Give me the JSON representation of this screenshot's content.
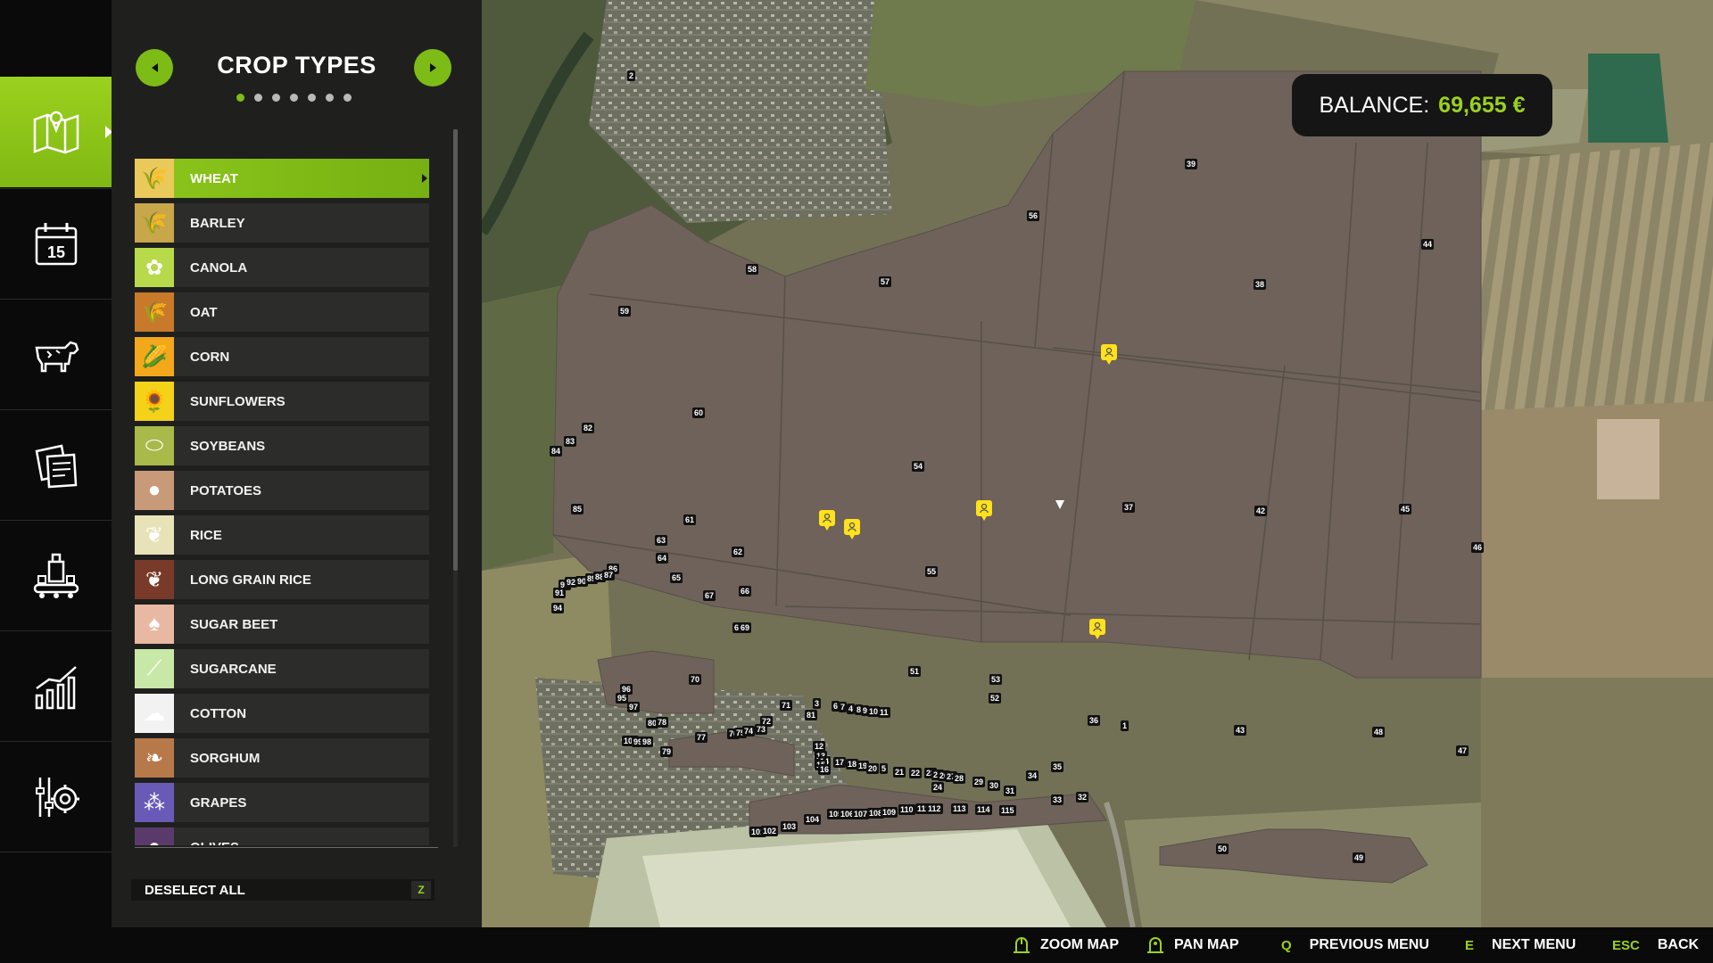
{
  "rail": {
    "items": [
      {
        "name": "map-icon",
        "active": true
      },
      {
        "name": "calendar-icon",
        "calendar_day": "15"
      },
      {
        "name": "animals-icon"
      },
      {
        "name": "contracts-icon"
      },
      {
        "name": "production-icon"
      },
      {
        "name": "statistics-icon"
      },
      {
        "name": "settings-icon"
      }
    ]
  },
  "panel": {
    "title": "CROP TYPES",
    "page_count": 7,
    "current_page": 1,
    "crops": [
      {
        "label": "WHEAT",
        "icon": "wheat-icon",
        "bg": "#e9c95a",
        "selected": true
      },
      {
        "label": "BARLEY",
        "icon": "barley-icon",
        "bg": "#c8a64a"
      },
      {
        "label": "CANOLA",
        "icon": "canola-icon",
        "bg": "#b8d94a"
      },
      {
        "label": "OAT",
        "icon": "oat-icon",
        "bg": "#c87a2a"
      },
      {
        "label": "CORN",
        "icon": "corn-icon",
        "bg": "#f2a81a"
      },
      {
        "label": "SUNFLOWERS",
        "icon": "sunflower-icon",
        "bg": "#f5d21a"
      },
      {
        "label": "SOYBEANS",
        "icon": "soybean-icon",
        "bg": "#a9b94a"
      },
      {
        "label": "POTATOES",
        "icon": "potato-icon",
        "bg": "#c99a7a"
      },
      {
        "label": "RICE",
        "icon": "rice-icon",
        "bg": "#e8e2b8"
      },
      {
        "label": "LONG GRAIN RICE",
        "icon": "long-grain-rice-icon",
        "bg": "#7a3a2a"
      },
      {
        "label": "SUGAR BEET",
        "icon": "sugar-beet-icon",
        "bg": "#e8b8a2"
      },
      {
        "label": "SUGARCANE",
        "icon": "sugarcane-icon",
        "bg": "#c8e8a8"
      },
      {
        "label": "COTTON",
        "icon": "cotton-icon",
        "bg": "#f2f2f2"
      },
      {
        "label": "SORGHUM",
        "icon": "sorghum-icon",
        "bg": "#b8794a"
      },
      {
        "label": "GRAPES",
        "icon": "grapes-icon",
        "bg": "#6a5ab8"
      },
      {
        "label": "OLIVES",
        "icon": "olive-icon",
        "bg": "#5a3a6a"
      }
    ],
    "deselect_label": "DESELECT ALL",
    "deselect_key": "Z"
  },
  "balance": {
    "label": "BALANCE:",
    "value": "69,655 €"
  },
  "map": {
    "field_numbers": [
      "2",
      "39",
      "56",
      "44",
      "58",
      "57",
      "38",
      "59",
      "60",
      "82",
      "83",
      "84",
      "54",
      "37",
      "42",
      "45",
      "85",
      "61",
      "63",
      "64",
      "62",
      "86",
      "93",
      "92",
      "90",
      "89",
      "88",
      "87",
      "91",
      "65",
      "67",
      "66",
      "94",
      "55",
      "46",
      "68",
      "69",
      "70",
      "51",
      "53",
      "52",
      "96",
      "95",
      "97",
      "71",
      "3",
      "6",
      "7",
      "4",
      "8",
      "9",
      "10",
      "11",
      "81",
      "36",
      "1",
      "43",
      "48",
      "47",
      "80",
      "78",
      "77",
      "76",
      "75",
      "74",
      "72",
      "73",
      "100",
      "99",
      "98",
      "79",
      "12",
      "13",
      "14",
      "15",
      "16",
      "17",
      "18",
      "19",
      "20",
      "5",
      "21",
      "22",
      "23",
      "25",
      "26",
      "27",
      "28",
      "29",
      "30",
      "31",
      "24",
      "34",
      "35",
      "33",
      "32",
      "104",
      "105",
      "106",
      "107",
      "108",
      "109",
      "110",
      "111",
      "112",
      "113",
      "114",
      "115",
      "101",
      "102",
      "103",
      "50",
      "49"
    ]
  },
  "help": {
    "zoom_label": "ZOOM MAP",
    "pan_label": "PAN MAP",
    "prev_key": "Q",
    "prev_label": "PREVIOUS MENU",
    "next_key": "E",
    "next_label": "NEXT MENU",
    "back_key": "ESC",
    "back_label": "BACK"
  },
  "colors": {
    "accent": "#7dbb17",
    "field": "#6e625a",
    "panel": "#1f201e"
  }
}
